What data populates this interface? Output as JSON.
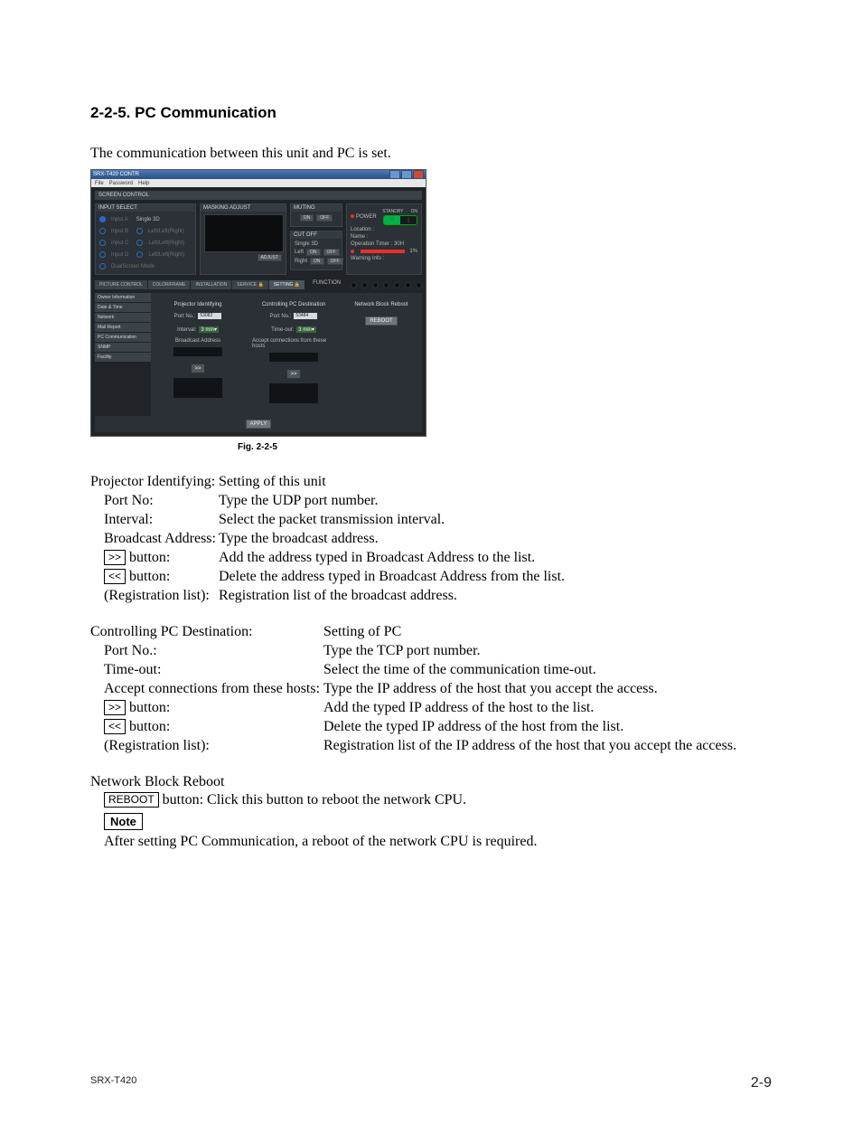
{
  "heading": "2-2-5.  PC Communication",
  "intro": "The communication between this unit and PC is set.",
  "fig_caption": "Fig. 2-2-5",
  "app": {
    "title": "SRX-T420 CONTR",
    "menu": [
      "File",
      "Password",
      "Help"
    ],
    "screen_control": "SCREEN CONTROL",
    "input_select": {
      "title": "INPUT SELECT",
      "rows": [
        {
          "a": "Input A",
          "b": "Single 3D"
        },
        {
          "a": "Input B",
          "b": "Left/Left(Right)"
        },
        {
          "a": "Input C",
          "b": "Left/Left(Right)"
        },
        {
          "a": "Input D",
          "b": "Left/Left(Right)"
        },
        {
          "a": "DualScreen Mode",
          "b": ""
        }
      ]
    },
    "masking": {
      "title": "MASKING ADJUST",
      "btn": "ADJUST"
    },
    "muting": {
      "title": "MUTING",
      "on": "ON",
      "off": "OFF"
    },
    "cutoff": {
      "title": "CUT OFF",
      "subtitle": "Single 3D",
      "left": "Left",
      "right": "Right",
      "on": "ON",
      "off": "OFF"
    },
    "power": {
      "title": "POWER",
      "standby": "STANDBY",
      "on": "ON",
      "power_icon": "⏻"
    },
    "status": {
      "location": "Location :",
      "name": "Name :",
      "timer": "Operation Timer : 30H",
      "warning": "Warning Info :",
      "bar_pct": "1%"
    },
    "tabs": [
      "PICTURE CONTROL",
      "COLOR/FRAME",
      "INSTALLATION",
      "SERVICE",
      "SETTING"
    ],
    "function_label": "FUNCTION",
    "side": [
      "Owner Information",
      "Date & Time",
      "Network",
      "Mail Report",
      "PC Communication",
      "SNMP",
      "Facility"
    ],
    "proj_identify": {
      "title": "Projector Identifying",
      "port_label": "Port No.:",
      "port": "53082",
      "interval_label": "Interval:",
      "interval": "3 min",
      "broadcast_label": "Broadcast Address"
    },
    "pc_dest": {
      "title": "Controlling PC Destination",
      "port_label": "Port No.:",
      "port": "53484",
      "timeout_label": "Time-out:",
      "timeout": "3 min",
      "accept_label": "Accept connections from these hosts"
    },
    "reboot_panel": {
      "title": "Network Block Reboot",
      "btn": "REBOOT"
    },
    "apply": "APPLY",
    "add_btn": ">>"
  },
  "list1": {
    "head_label": "Projector Identifying:",
    "head_value": "Setting of this unit",
    "rows": [
      {
        "l": "Port No:",
        "v": "Type the UDP port number."
      },
      {
        "l": "Interval:",
        "v": "Select the packet transmission interval."
      },
      {
        "l": "Broadcast Address:",
        "v": "Type the broadcast address."
      }
    ],
    "btn_add": ">>",
    "btn_add_sfx": " button:",
    "btn_add_v": "Add the address typed in Broadcast Address to the list.",
    "btn_del": "<<",
    "btn_del_sfx": " button:",
    "btn_del_v": "Delete the address typed in Broadcast Address from the list.",
    "reg_l": "(Registration list):",
    "reg_v": "Registration list of the broadcast address."
  },
  "list2": {
    "head_label": "Controlling PC Destination:",
    "head_value": "Setting of PC",
    "rows": [
      {
        "l": "Port No.:",
        "v": "Type the TCP port number."
      },
      {
        "l": "Time-out:",
        "v": "Select the time of the communication time-out."
      },
      {
        "l": "Accept connections from these hosts:",
        "v": "Type the IP address of the host that you accept the access."
      }
    ],
    "btn_add": ">>",
    "btn_add_sfx": " button:",
    "btn_add_v": "Add the typed IP address of the host to the list.",
    "btn_del": "<<",
    "btn_del_sfx": " button:",
    "btn_del_v": "Delete the typed IP address of the host from the list.",
    "reg_l": "(Registration list):",
    "reg_v": "Registration list of the IP address of the host that you accept the access."
  },
  "reboot": {
    "head": "Network Block Reboot",
    "btn": "REBOOT",
    "btn_sfx": " button:",
    "btn_v": "Click this button to reboot the network CPU.",
    "note_label": "Note",
    "note_text": "After setting PC Communication, a reboot of the network CPU is required."
  },
  "footer": {
    "model": "SRX-T420",
    "page": "2-9"
  }
}
